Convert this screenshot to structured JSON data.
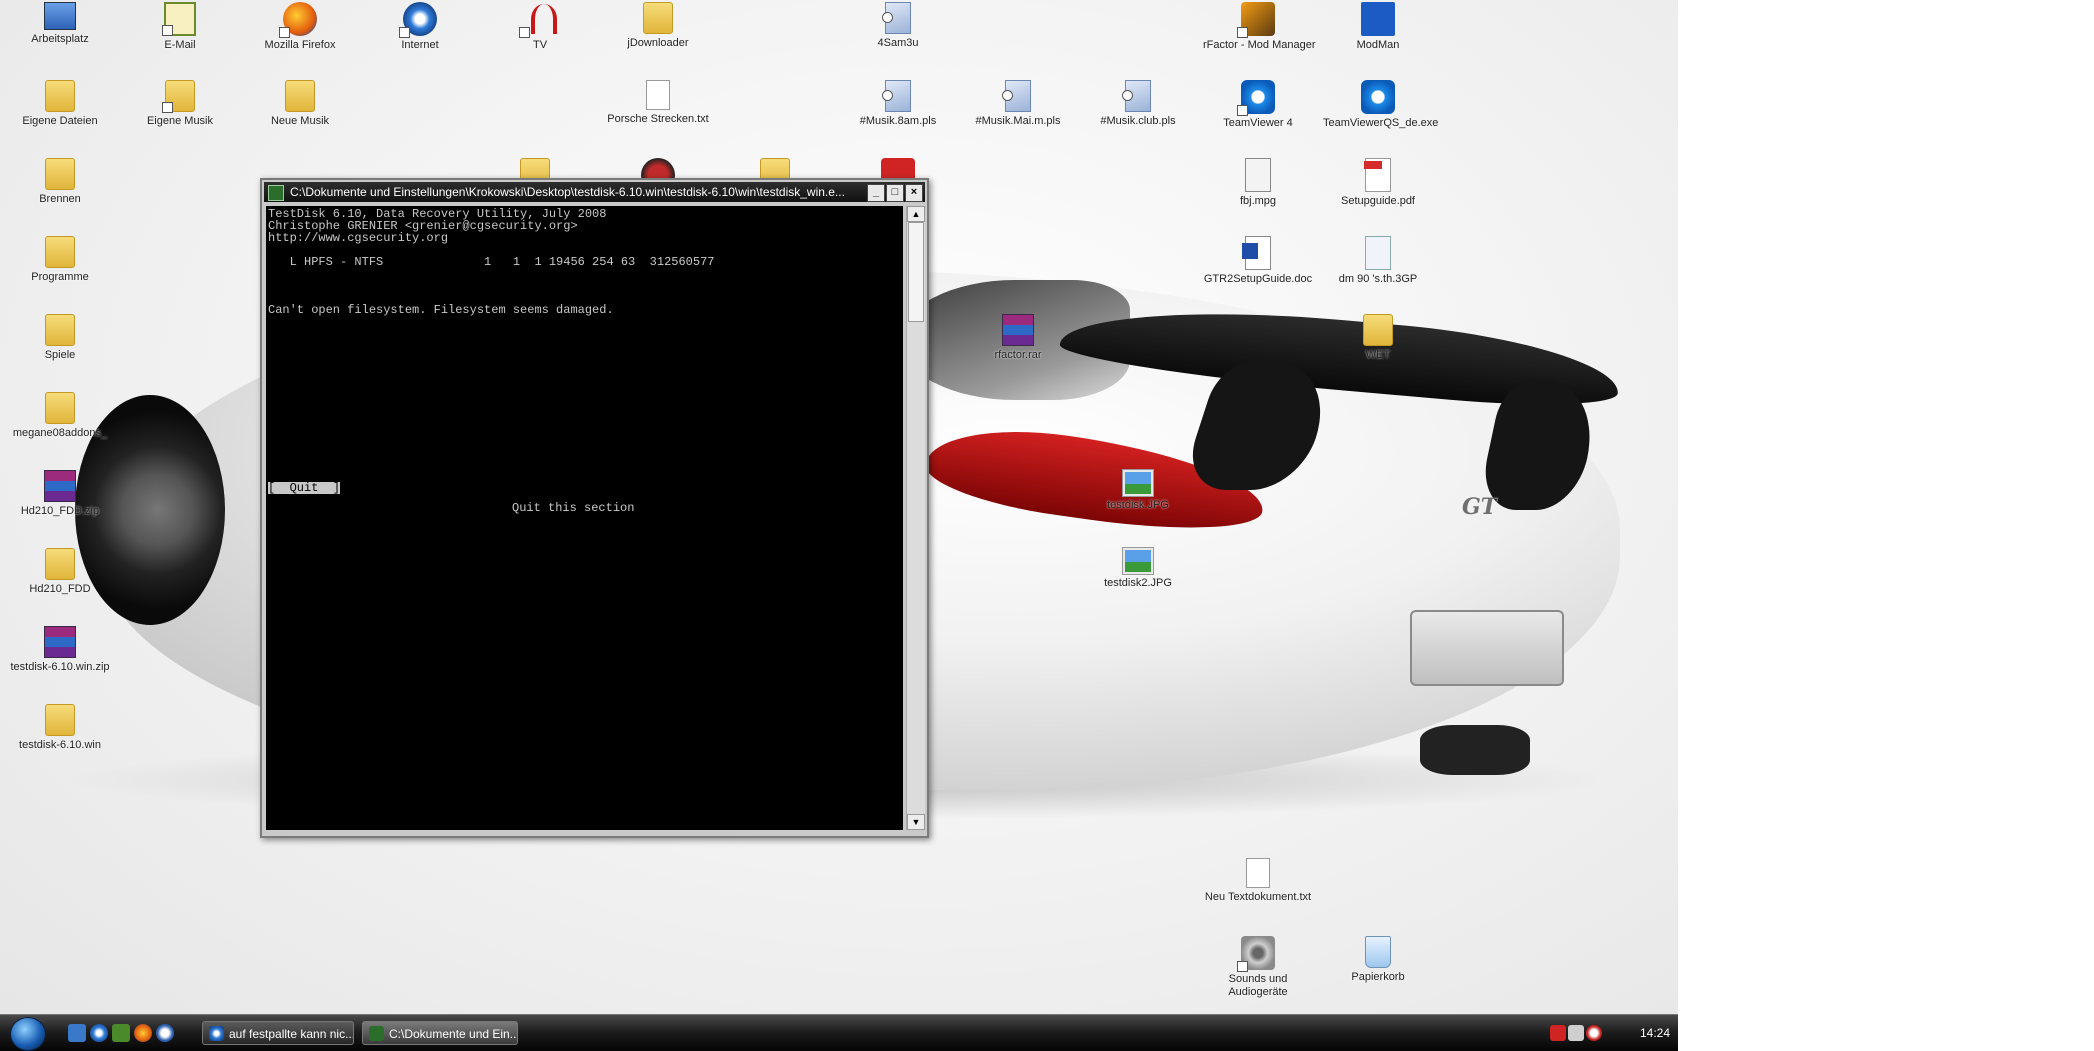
{
  "desktop": {
    "icons": {
      "arbeitsplatz": "Arbeitsplatz",
      "email": "E-Mail",
      "firefox": "Mozilla Firefox",
      "internet": "Internet",
      "tv": "TV",
      "jdownloader": "jDownloader",
      "file_4sam3u": "4Sam3u",
      "rfactor_modmanager": "rFactor - Mod Manager",
      "modman": "ModMan",
      "eigene_dateien": "Eigene Dateien",
      "eigene_musik": "Eigene Musik",
      "neue_musik": "Neue Musik",
      "porsche_strecken": "Porsche Strecken.txt",
      "musik_sampls": "#Musik.8am.pls",
      "musik_mainpls": "#Musik.Mai.m.pls",
      "musik_clubpls": "#Musik.club.pls",
      "teamviewer4": "TeamViewer 4",
      "teamviewerqs": "TeamViewerQS_de.exe",
      "brennen": "Brennen",
      "fbjmpg": "fbj.mpg",
      "setupguide": "Setupguide.pdf",
      "programme": "Programme",
      "gtr2setup": "GTR2SetupGuide.doc",
      "dm3gp": "dm 90 's.th.3GP",
      "spiele": "Spiele",
      "rfactorrar": "rfactor.rar",
      "wet": "WET",
      "megane": "megane08addons_",
      "hd210fddzip": "Hd210_FDD.zip",
      "testdiskjpg": "testdisk.JPG",
      "hd210fdd": "Hd210_FDD",
      "testdisk2jpg": "testdisk2.JPG",
      "testdiskwinzip": "testdisk-6.10.win.zip",
      "testdiskwin": "testdisk-6.10.win",
      "neutextdok": "Neu Textdokument.txt",
      "sounds": "Sounds und Audiogeräte",
      "papierkorb": "Papierkorb"
    }
  },
  "console_window": {
    "title": "C:\\Dokumente und Einstellungen\\Krokowski\\Desktop\\testdisk-6.10.win\\testdisk-6.10\\win\\testdisk_win.e...",
    "minimize": "_",
    "maximize": "□",
    "close": "×",
    "lines": {
      "l1": "TestDisk 6.10, Data Recovery Utility, July 2008",
      "l2": "Christophe GRENIER <grenier@cgsecurity.org>",
      "l3": "http://www.cgsecurity.org",
      "partition": "   L HPFS - NTFS              1   1  1 19456 254 63  312560577",
      "error": "Can't open filesystem. Filesystem seems damaged.",
      "quit_button": "[  Quit  ]",
      "quit_hint": "Quit this section"
    }
  },
  "taskbar": {
    "tasks": {
      "firefox_task": "auf festpallte kann nic...",
      "console_task": "C:\\Dokumente und Ein..."
    },
    "clock": "14:24"
  }
}
